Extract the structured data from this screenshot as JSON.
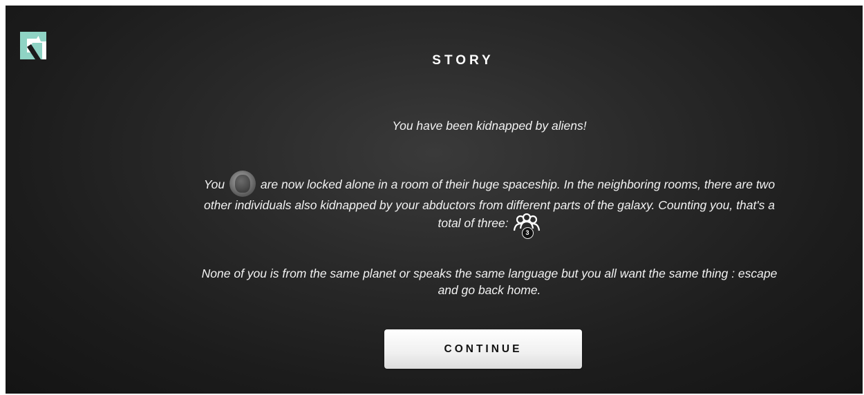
{
  "logo": {
    "icon": "game-logo-icon",
    "colors": [
      "#8fd3c4",
      "#ffffff",
      "#1a1a1a"
    ]
  },
  "story": {
    "title": "STORY",
    "intro": "You have been kidnapped by aliens!",
    "para2": {
      "prefix": "You",
      "avatar_icon": "player-avatar-icon",
      "suffix": "are now locked alone in a room of their huge spaceship. In the neighboring rooms, there are two other individuals also kidnapped by your abductors from different parts of the galaxy. Counting you, that's a total of three:",
      "group_icon": "players-group-icon",
      "group_count": "3"
    },
    "para3": "None of you is from the same planet or speaks the same language but you all want the same thing : escape and go back home."
  },
  "continue_label": "CONTINUE",
  "colors": {
    "background": "#1c1c1c",
    "text": "#f2f2f2",
    "button": "#f0f0f0"
  }
}
